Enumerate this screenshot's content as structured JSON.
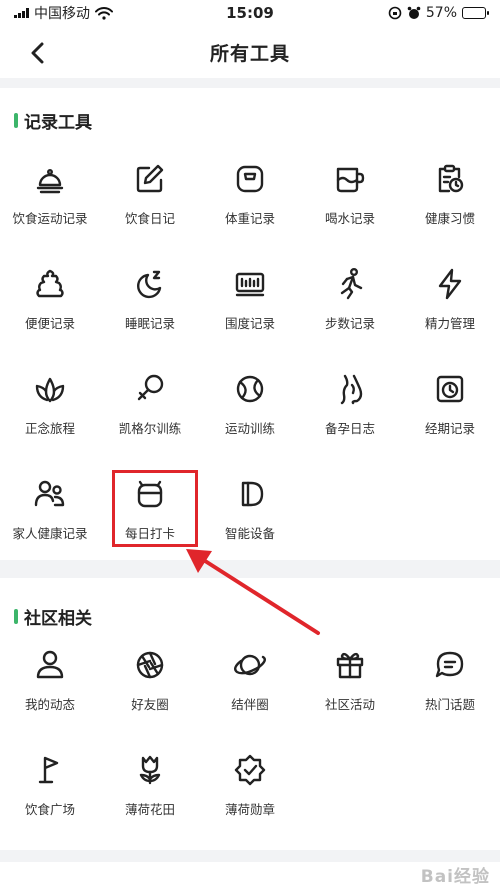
{
  "status_bar": {
    "carrier": "中国移动",
    "time": "15:09",
    "battery": "57%",
    "battery_level": 0.57
  },
  "nav": {
    "title": "所有工具"
  },
  "sections": {
    "record": {
      "title": "记录工具",
      "items": [
        {
          "label": "饮食运动记录",
          "icon": "cloche-icon"
        },
        {
          "label": "饮食日记",
          "icon": "edit-note-icon"
        },
        {
          "label": "体重记录",
          "icon": "scale-icon"
        },
        {
          "label": "喝水记录",
          "icon": "cup-icon"
        },
        {
          "label": "健康习惯",
          "icon": "clipboard-clock-icon"
        },
        {
          "label": "便便记录",
          "icon": "poop-icon"
        },
        {
          "label": "睡眠记录",
          "icon": "moon-zzz-icon"
        },
        {
          "label": "围度记录",
          "icon": "tape-measure-icon"
        },
        {
          "label": "步数记录",
          "icon": "running-person-icon"
        },
        {
          "label": "精力管理",
          "icon": "lightning-icon"
        },
        {
          "label": "正念旅程",
          "icon": "lotus-icon"
        },
        {
          "label": "凯格尔训练",
          "icon": "female-symbol-icon"
        },
        {
          "label": "运动训练",
          "icon": "ball-icon"
        },
        {
          "label": "备孕日志",
          "icon": "pregnancy-icon"
        },
        {
          "label": "经期记录",
          "icon": "calendar-clock-icon"
        },
        {
          "label": "家人健康记录",
          "icon": "family-icon"
        },
        {
          "label": "每日打卡",
          "icon": "daily-checkin-icon"
        },
        {
          "label": "智能设备",
          "icon": "smart-device-icon"
        }
      ]
    },
    "community": {
      "title": "社区相关",
      "items": [
        {
          "label": "我的动态",
          "icon": "user-icon"
        },
        {
          "label": "好友圈",
          "icon": "aperture-icon"
        },
        {
          "label": "结伴圈",
          "icon": "planet-icon"
        },
        {
          "label": "社区活动",
          "icon": "gift-icon"
        },
        {
          "label": "热门话题",
          "icon": "chat-bubble-icon"
        },
        {
          "label": "饮食广场",
          "icon": "flag-icon"
        },
        {
          "label": "薄荷花田",
          "icon": "tulip-icon"
        },
        {
          "label": "薄荷勋章",
          "icon": "badge-check-icon"
        }
      ]
    }
  },
  "watermark": "Bai经验",
  "colors": {
    "accent": "#3cb56a",
    "highlight": "#e0262b",
    "icon_stroke": "#222222"
  }
}
